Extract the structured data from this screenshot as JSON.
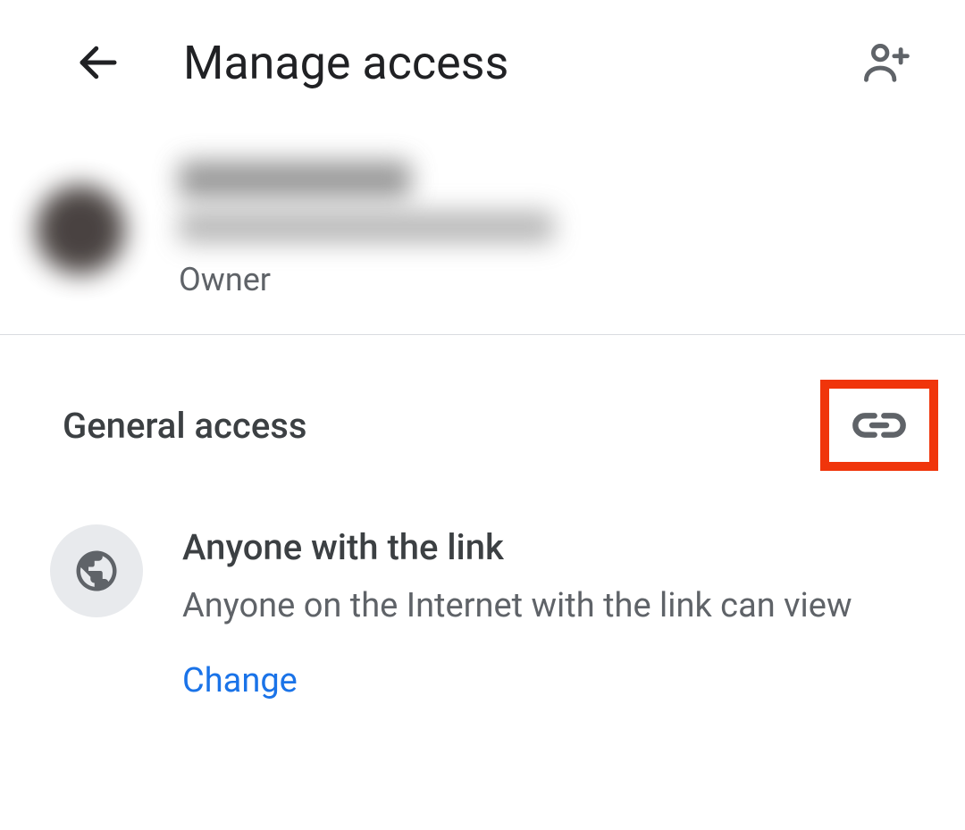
{
  "header": {
    "title": "Manage access"
  },
  "owner": {
    "role_label": "Owner"
  },
  "general_access": {
    "section_title": "General access",
    "title": "Anyone with the link",
    "description": "Anyone on the Internet with the link can view",
    "change_label": "Change"
  }
}
